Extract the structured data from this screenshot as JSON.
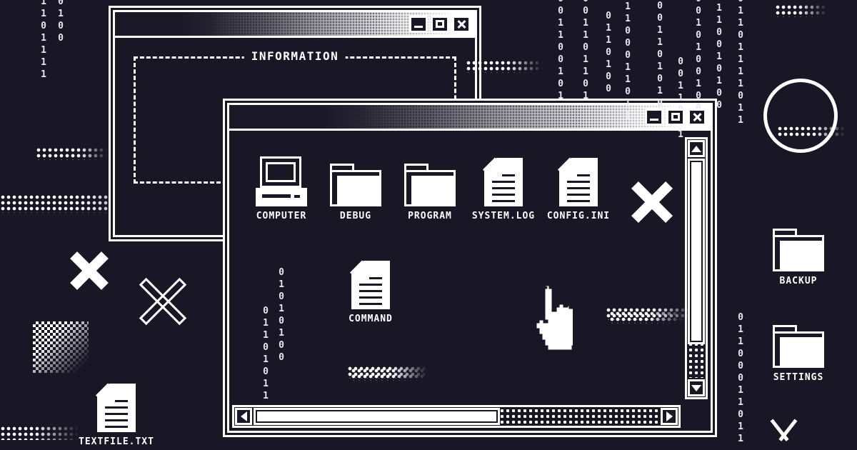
{
  "theme": {
    "background": "#191626",
    "foreground": "#ffffff"
  },
  "back_window": {
    "name": "information-window",
    "groupbox_label": "INFORMATION",
    "buttons": [
      {
        "name": "minimize-button",
        "glyph": "minimize-icon",
        "label": "_"
      },
      {
        "name": "maximize-button",
        "glyph": "maximize-icon",
        "label": "□"
      },
      {
        "name": "close-button",
        "glyph": "close-icon",
        "label": "×"
      }
    ]
  },
  "front_window": {
    "name": "file-manager-window",
    "buttons": [
      {
        "name": "minimize-button",
        "glyph": "minimize-icon",
        "label": "_"
      },
      {
        "name": "maximize-button",
        "glyph": "maximize-icon",
        "label": "□"
      },
      {
        "name": "close-button",
        "glyph": "close-icon",
        "label": "×"
      }
    ],
    "icons": [
      {
        "label": "COMPUTER",
        "type": "computer-icon"
      },
      {
        "label": "DEBUG",
        "type": "folder-icon"
      },
      {
        "label": "PROGRAM",
        "type": "folder-icon"
      },
      {
        "label": "SYSTEM.LOG",
        "type": "document-icon"
      },
      {
        "label": "CONFIG.INI",
        "type": "document-icon"
      },
      {
        "label": "COMMAND",
        "type": "document-icon"
      }
    ],
    "delete_marker": "✕",
    "cursor": "pointing-hand-cursor",
    "scrollbars": {
      "vertical": {
        "up": "▲",
        "down": "▼"
      },
      "horizontal": {
        "left": "◀",
        "right": "▶"
      }
    },
    "binary_strings": [
      "01101011",
      "01010100"
    ]
  },
  "desktop_icons": [
    {
      "label": "BACKUP",
      "type": "folder-icon"
    },
    {
      "label": "SETTINGS",
      "type": "folder-icon"
    },
    {
      "label": "TEXTFILE.TXT",
      "type": "document-icon"
    }
  ],
  "binary_rain": {
    "left": [
      "1101111",
      "0100"
    ],
    "right": [
      "001100101",
      "001101101",
      "0110100",
      "01100011011",
      "0011010101",
      "0011001",
      "0010100100",
      "0110010100",
      "01101111011"
    ]
  },
  "decorations": {
    "circle": "circle-outline",
    "chevron": "chevron-down-icon",
    "x_solid": "x-mark-solid",
    "x_outline": "x-mark-outline",
    "dither_block": "dither-gradient-block"
  }
}
